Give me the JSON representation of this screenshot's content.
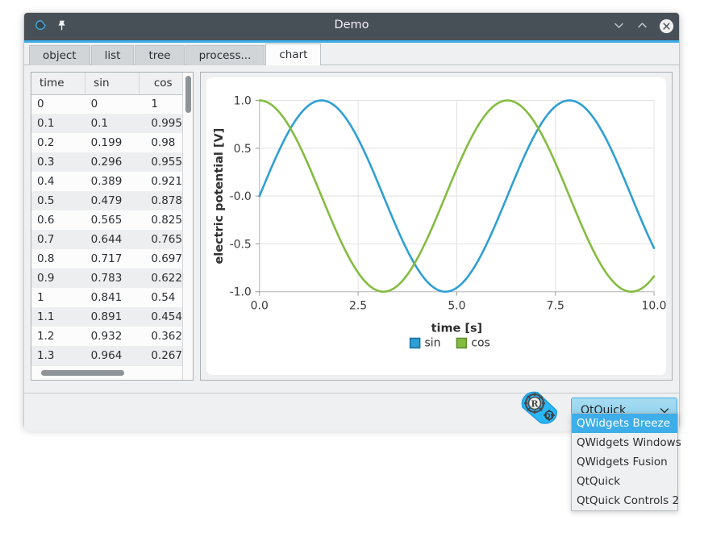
{
  "window": {
    "title": "Demo",
    "icon": "qt-logo-icon",
    "pin_icon": "pin-icon",
    "controls": [
      {
        "name": "minimize-button",
        "icon": "chevron-down-icon"
      },
      {
        "name": "maximize-button",
        "icon": "chevron-up-icon"
      },
      {
        "name": "close-button",
        "icon": "close-circle-icon"
      }
    ]
  },
  "tabs": [
    {
      "label": "object",
      "active": false
    },
    {
      "label": "list",
      "active": false
    },
    {
      "label": "tree",
      "active": false
    },
    {
      "label": "process...",
      "active": false
    },
    {
      "label": "chart",
      "active": true
    }
  ],
  "table": {
    "columns": [
      "time",
      "sin",
      "cos"
    ],
    "rows": [
      [
        "0",
        "0",
        "1"
      ],
      [
        "0.1",
        "0.1",
        "0.995"
      ],
      [
        "0.2",
        "0.199",
        "0.98"
      ],
      [
        "0.3",
        "0.296",
        "0.955"
      ],
      [
        "0.4",
        "0.389",
        "0.921"
      ],
      [
        "0.5",
        "0.479",
        "0.878"
      ],
      [
        "0.6",
        "0.565",
        "0.825"
      ],
      [
        "0.7",
        "0.644",
        "0.765"
      ],
      [
        "0.8",
        "0.717",
        "0.697"
      ],
      [
        "0.9",
        "0.783",
        "0.622"
      ],
      [
        "1",
        "0.841",
        "0.54"
      ],
      [
        "1.1",
        "0.891",
        "0.454"
      ],
      [
        "1.2",
        "0.932",
        "0.362"
      ],
      [
        "1.3",
        "0.964",
        "0.267"
      ]
    ]
  },
  "chart_data": {
    "type": "line",
    "title": "",
    "xlabel": "time [s]",
    "ylabel": "electric potential [V]",
    "xlim": [
      0,
      10
    ],
    "ylim": [
      -1,
      1
    ],
    "xticks": [
      "0.0",
      "2.5",
      "5.0",
      "7.5",
      "10.0"
    ],
    "xtick_values": [
      0,
      2.5,
      5,
      7.5,
      10
    ],
    "yticks": [
      "1.0",
      "0.5",
      "-0.0",
      "-0.5",
      "-1.0"
    ],
    "ytick_values": [
      1,
      0.5,
      0,
      -0.5,
      -1
    ],
    "grid": true,
    "legend_position": "bottom",
    "series": [
      {
        "name": "sin",
        "color": "#2e9fd4",
        "function": "sin",
        "x": [
          0,
          0.25,
          0.5,
          0.75,
          1,
          1.25,
          1.5,
          1.75,
          2,
          2.25,
          2.5,
          2.75,
          3,
          3.25,
          3.5,
          3.75,
          4,
          4.25,
          4.5,
          4.75,
          5,
          5.25,
          5.5,
          5.75,
          6,
          6.25,
          6.5,
          6.75,
          7,
          7.25,
          7.5,
          7.75,
          8,
          8.25,
          8.5,
          8.75,
          9,
          9.25,
          9.5,
          9.75,
          10
        ],
        "values": [
          0,
          0.247,
          0.479,
          0.682,
          0.841,
          0.949,
          0.997,
          0.984,
          0.909,
          0.778,
          0.599,
          0.382,
          0.141,
          -0.108,
          -0.351,
          -0.572,
          -0.757,
          -0.895,
          -0.978,
          -0.999,
          -0.959,
          -0.858,
          -0.706,
          -0.512,
          -0.279,
          -0.034,
          0.215,
          0.45,
          0.657,
          0.82,
          0.938,
          0.995,
          0.989,
          0.92,
          0.798,
          0.625,
          0.412,
          0.174,
          -0.075,
          -0.32,
          -0.544
        ]
      },
      {
        "name": "cos",
        "color": "#84bc40",
        "function": "cos",
        "x": [
          0,
          0.25,
          0.5,
          0.75,
          1,
          1.25,
          1.5,
          1.75,
          2,
          2.25,
          2.5,
          2.75,
          3,
          3.25,
          3.5,
          3.75,
          4,
          4.25,
          4.5,
          4.75,
          5,
          5.25,
          5.5,
          5.75,
          6,
          6.25,
          6.5,
          6.75,
          7,
          7.25,
          7.5,
          7.75,
          8,
          8.25,
          8.5,
          8.75,
          9,
          9.25,
          9.5,
          9.75,
          10
        ],
        "values": [
          1,
          0.969,
          0.878,
          0.732,
          0.54,
          0.315,
          0.071,
          -0.178,
          -0.416,
          -0.628,
          -0.801,
          -0.924,
          -0.99,
          -0.994,
          -0.936,
          -0.821,
          -0.654,
          -0.446,
          -0.211,
          0.036,
          0.284,
          0.513,
          0.709,
          0.859,
          0.96,
          0.999,
          0.977,
          0.893,
          0.754,
          0.572,
          0.347,
          0.103,
          -0.146,
          -0.391,
          -0.602,
          -0.781,
          -0.911,
          -0.985,
          -0.997,
          -0.947,
          -0.839
        ]
      }
    ]
  },
  "bottom": {
    "logo_icon": "rust-qt-logo-icon",
    "combo": {
      "selected": "QtQuick",
      "arrow_icon": "chevron-down-icon",
      "options": [
        {
          "label": "QWidgets Breeze",
          "selected": true
        },
        {
          "label": "QWidgets Windows",
          "selected": false
        },
        {
          "label": "QWidgets Fusion",
          "selected": false
        },
        {
          "label": "QtQuick",
          "selected": false
        },
        {
          "label": "QtQuick Controls 2",
          "selected": false
        }
      ]
    }
  },
  "colors": {
    "titlebar": "#475057",
    "accent": "#3daee9",
    "sin": "#2e9fd4",
    "cos": "#84bc40",
    "window_bg": "#eff0f1"
  }
}
